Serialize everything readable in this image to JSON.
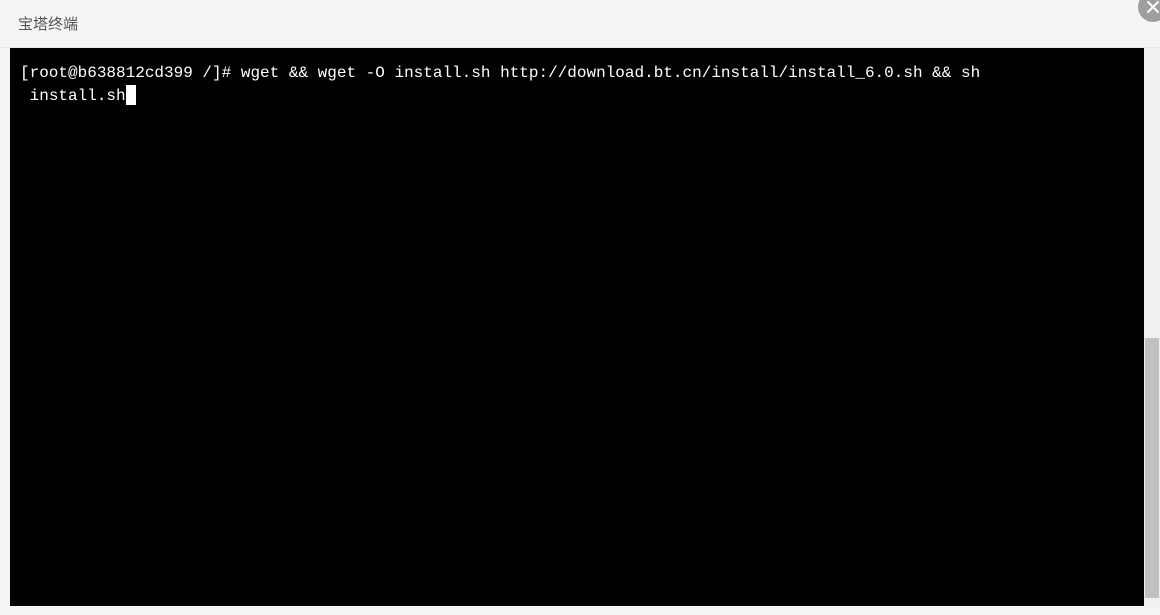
{
  "header": {
    "title": "宝塔终端"
  },
  "terminal": {
    "prompt": "[root@b638812cd399 /]# ",
    "command_line1": "wget && wget -O install.sh http://download.bt.cn/install/install_6.0.sh && sh",
    "command_line2": " install.sh"
  },
  "icons": {
    "close": "close-icon"
  }
}
